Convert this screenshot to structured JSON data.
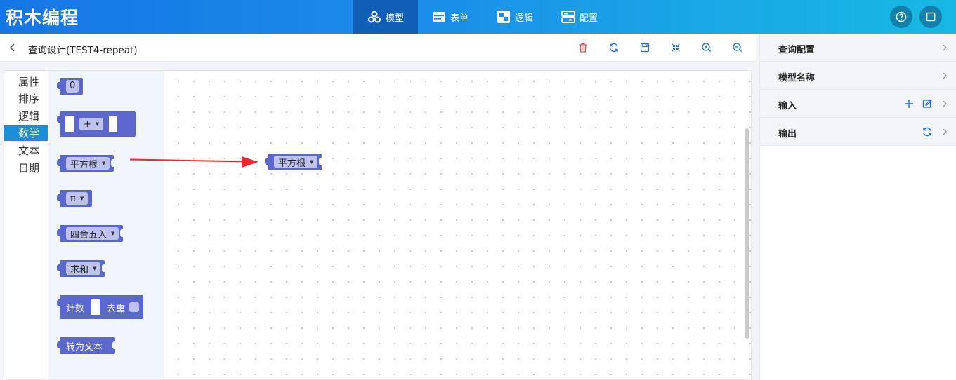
{
  "app": {
    "title": "积木编程"
  },
  "nav": [
    {
      "label": "模型",
      "icon": "model-icon",
      "active": true
    },
    {
      "label": "表单",
      "icon": "form-icon",
      "active": false
    },
    {
      "label": "逻辑",
      "icon": "logic-icon",
      "active": false
    },
    {
      "label": "配置",
      "icon": "config-icon",
      "active": false
    }
  ],
  "topRight": {
    "help_icon": "help-icon",
    "fullscreen_icon": "fullscreen-icon"
  },
  "subheader": {
    "title": "查询设计(TEST4-repeat)",
    "tools": [
      "delete-icon",
      "refresh-icon",
      "save-icon",
      "collapse-icon",
      "zoom-in-icon",
      "zoom-out-icon"
    ]
  },
  "categories": [
    "属性",
    "排序",
    "逻辑",
    "数学",
    "文本",
    "日期"
  ],
  "activeCategory": "数学",
  "flyout": {
    "number": "0",
    "arith_op": "+",
    "sqrt": "平方根",
    "pi": "π",
    "round": "四舍五入",
    "sum": "求和",
    "count_label": "计数",
    "dedupe_label": "去重",
    "to_text": "转为文本"
  },
  "canvas": {
    "placed_block": "平方根"
  },
  "colors": {
    "block": "#5b67cc",
    "field": "#bec2ef",
    "accent": "#1d8fd9",
    "delete": "#e8474a",
    "arrow": "#e52a2a"
  },
  "rightPanel": {
    "query_config": "查询配置",
    "model_name": "模型名称",
    "input": "输入",
    "output": "输出"
  }
}
